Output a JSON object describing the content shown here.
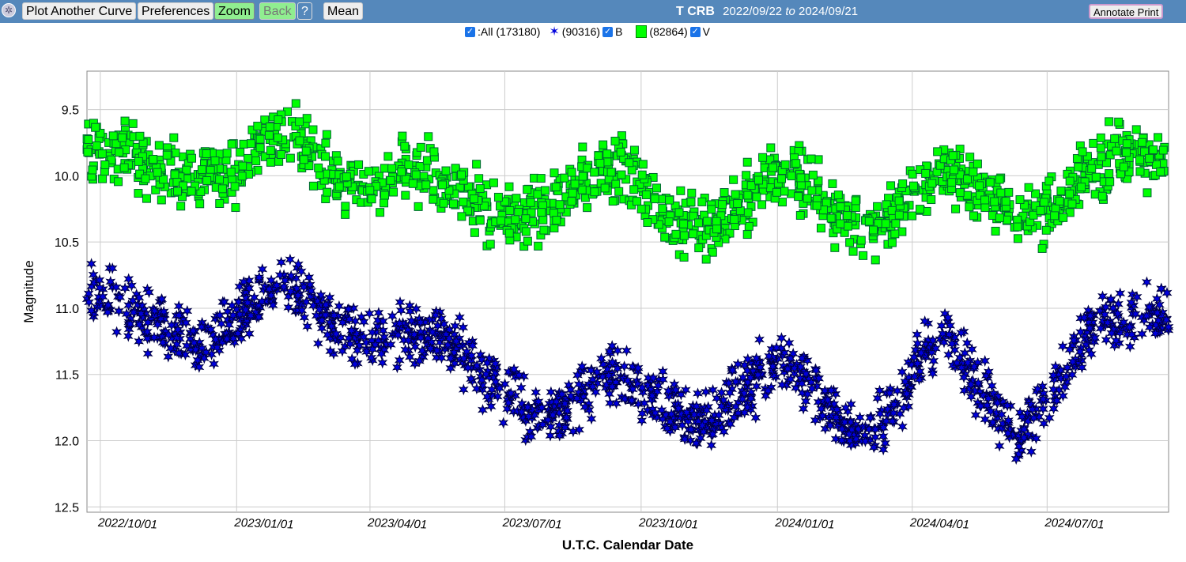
{
  "toolbar": {
    "plot_another": "Plot Another Curve",
    "preferences": "Preferences",
    "zoom": "Zoom",
    "back": "Back",
    "help": "?",
    "mean": "Mean",
    "annotate": "Annotate Print"
  },
  "header": {
    "star": "T CRB",
    "start": "2022/09/22",
    "to": "to",
    "end": "2024/09/21"
  },
  "legend": {
    "all": ":All (173180)",
    "b_count": "(90316)",
    "b_label": "B",
    "v_count": "(82864)",
    "v_label": "V"
  },
  "chart_data": {
    "type": "scatter",
    "xlabel": "U.T.C. Calendar Date",
    "ylabel": "Magnitude",
    "xlim": [
      "2022-09-22",
      "2024-09-21"
    ],
    "ylim": [
      12.54,
      9.21
    ],
    "y_inverted": true,
    "grid": true,
    "xticks": [
      "2022/10/01",
      "2023/01/01",
      "2023/04/01",
      "2023/07/01",
      "2023/10/01",
      "2024/01/01",
      "2024/04/01",
      "2024/07/01"
    ],
    "yticks": [
      "9.5",
      "10.0",
      "10.5",
      "11.0",
      "11.5",
      "12.0",
      "12.5"
    ],
    "legend_position": "top",
    "series": [
      {
        "name": "V",
        "count": 82864,
        "color": "#00ff00",
        "marker": "square",
        "x": [
          "2022-09-22",
          "2022-10-15",
          "2022-11-01",
          "2022-11-20",
          "2022-12-15",
          "2023-01-01",
          "2023-01-20",
          "2023-02-05",
          "2023-02-25",
          "2023-03-15",
          "2023-04-01",
          "2023-04-20",
          "2023-05-10",
          "2023-06-01",
          "2023-06-20",
          "2023-07-10",
          "2023-08-01",
          "2023-08-20",
          "2023-09-15",
          "2023-10-01",
          "2023-10-20",
          "2023-11-10",
          "2023-11-25",
          "2023-12-15",
          "2024-01-01",
          "2024-01-20",
          "2024-02-10",
          "2024-03-01",
          "2024-03-20",
          "2024-04-10",
          "2024-04-25",
          "2024-05-10",
          "2024-06-01",
          "2024-06-20",
          "2024-07-10",
          "2024-08-01",
          "2024-08-20",
          "2024-09-21"
        ],
        "y": [
          9.82,
          9.78,
          9.9,
          10.0,
          10.05,
          9.95,
          9.75,
          9.7,
          9.85,
          10.05,
          10.1,
          9.95,
          9.95,
          10.1,
          10.25,
          10.35,
          10.2,
          10.05,
          9.95,
          10.05,
          10.3,
          10.4,
          10.35,
          10.1,
          10.0,
          10.05,
          10.3,
          10.4,
          10.3,
          10.05,
          9.95,
          10.05,
          10.25,
          10.3,
          10.2,
          9.95,
          9.85,
          9.9
        ]
      },
      {
        "name": "B",
        "count": 90316,
        "color": "#0000dd",
        "marker": "star",
        "x": [
          "2022-09-22",
          "2022-10-15",
          "2022-11-05",
          "2022-12-10",
          "2022-12-25",
          "2023-01-15",
          "2023-02-05",
          "2023-02-25",
          "2023-03-15",
          "2023-04-10",
          "2023-05-01",
          "2023-05-20",
          "2023-06-10",
          "2023-07-01",
          "2023-07-20",
          "2023-08-10",
          "2023-09-01",
          "2023-09-15",
          "2023-10-01",
          "2023-10-25",
          "2023-11-15",
          "2023-12-10",
          "2024-01-01",
          "2024-01-20",
          "2024-02-10",
          "2024-03-01",
          "2024-03-20",
          "2024-04-10",
          "2024-04-25",
          "2024-05-15",
          "2024-06-01",
          "2024-06-15",
          "2024-07-01",
          "2024-07-20",
          "2024-08-10",
          "2024-09-21"
        ],
        "y": [
          10.9,
          10.95,
          11.1,
          11.3,
          11.1,
          10.95,
          10.8,
          11.0,
          11.2,
          11.25,
          11.15,
          11.2,
          11.45,
          11.65,
          11.85,
          11.75,
          11.55,
          11.5,
          11.6,
          11.8,
          11.9,
          11.6,
          11.4,
          11.5,
          11.85,
          11.95,
          11.8,
          11.3,
          11.15,
          11.6,
          11.85,
          11.95,
          11.7,
          11.3,
          11.1,
          11.1
        ]
      }
    ]
  }
}
